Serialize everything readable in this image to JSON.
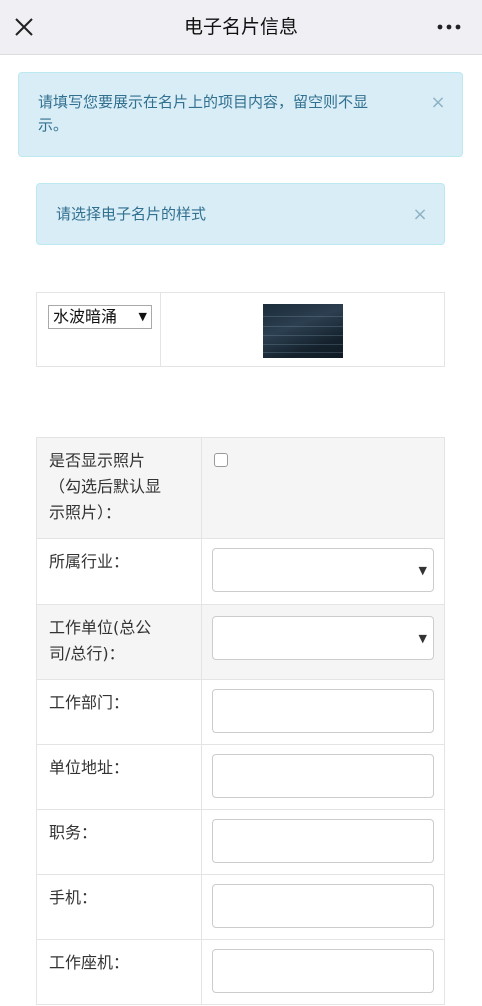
{
  "nav": {
    "title": "电子名片信息",
    "close_icon": "close-x-icon",
    "more_icon": "ellipsis-icon"
  },
  "alerts": {
    "info1": {
      "text_line1": "请填写您要展示在名片上的项目内容，留空则不显",
      "text_line2": "示。",
      "close": "×"
    },
    "info2": {
      "text": "请选择电子名片的样式",
      "close": "×"
    }
  },
  "style_picker": {
    "selected": "水波暗涌",
    "arrow": "▼"
  },
  "form": {
    "show_photo_line1": "是否显示照片",
    "show_photo_line2": "（勾选后默认显",
    "show_photo_line3": "示照片）：",
    "industry": "所属行业：",
    "company_line1": "工作单位(总公",
    "company_line2": "司/总行)：",
    "department": "工作部门：",
    "address": "单位地址：",
    "position": "职务：",
    "mobile": "手机：",
    "office_phone": "工作座机：",
    "select_arrow": "▼"
  },
  "colors": {
    "alert_bg": "#d9edf7",
    "alert_text": "#31708f",
    "nav_bg": "#efeff4"
  }
}
